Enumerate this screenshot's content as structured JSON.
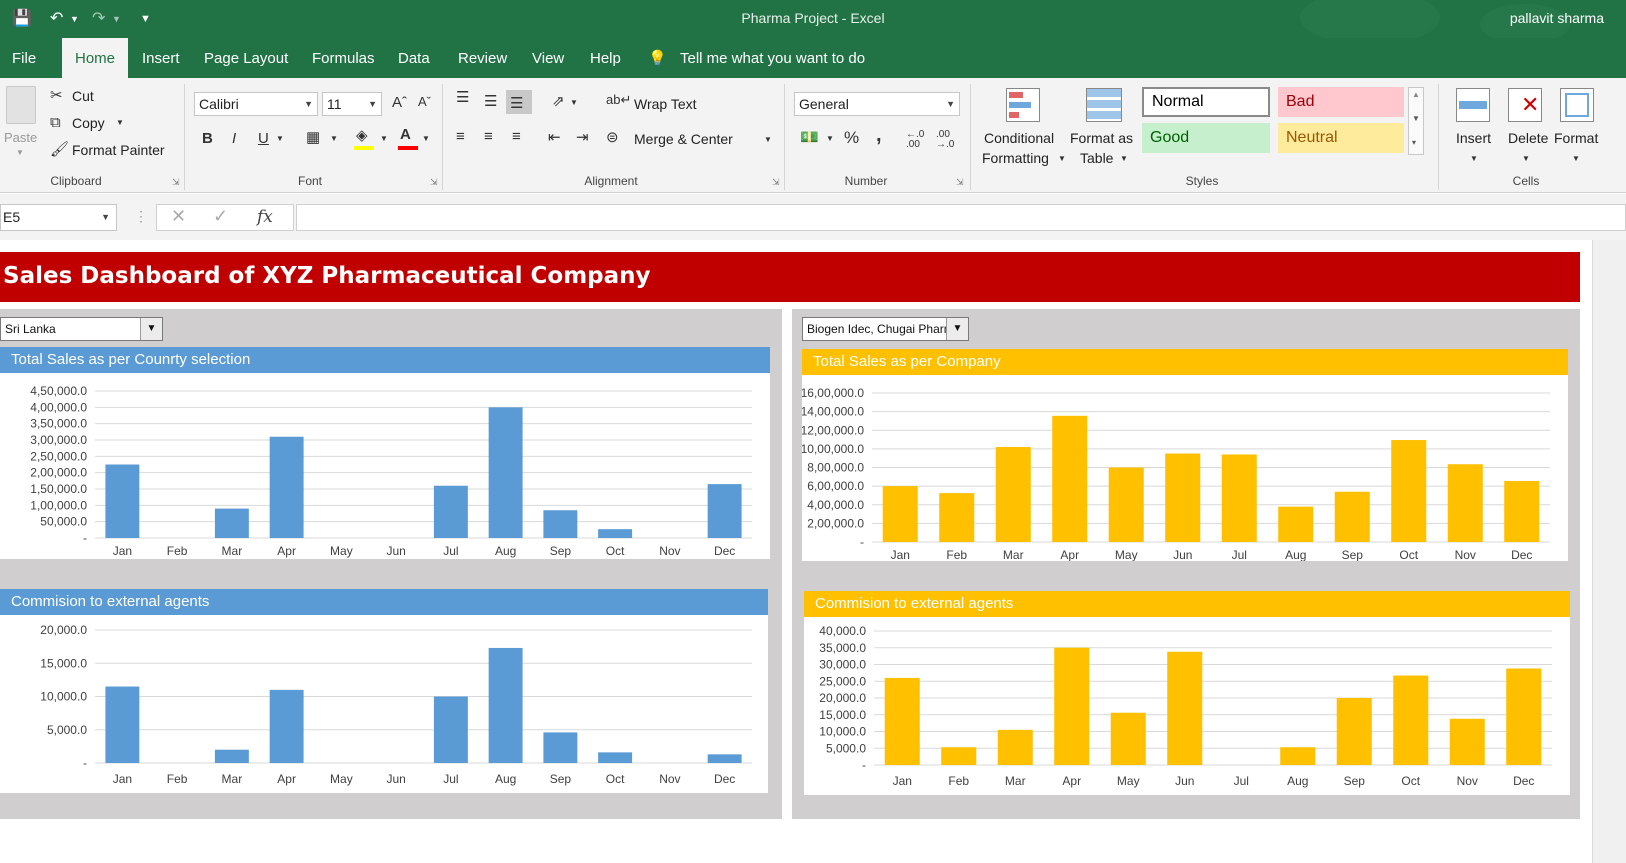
{
  "app": {
    "title": "Pharma Project  -  Excel",
    "user": "pallavit sharma"
  },
  "menu": {
    "tabs": [
      "File",
      "Home",
      "Insert",
      "Page Layout",
      "Formulas",
      "Data",
      "Review",
      "View",
      "Help"
    ],
    "active_tab": "Home",
    "tell_me": "Tell me what you want to do"
  },
  "ribbon": {
    "clipboard": {
      "paste": "Paste",
      "cut": "Cut",
      "copy": "Copy",
      "format_painter": "Format Painter",
      "label": "Clipboard"
    },
    "font": {
      "family": "Calibri",
      "size": "11",
      "label": "Font",
      "bold": "B",
      "italic": "I",
      "underline": "U"
    },
    "alignment": {
      "wrap_text": "Wrap Text",
      "merge_center": "Merge & Center",
      "label": "Alignment"
    },
    "number": {
      "format": "General",
      "percent": "%",
      "comma": ",",
      "label": "Number",
      "inc_decimal": "←.0\n.00",
      "dec_decimal": ".00\n→.0"
    },
    "styles": {
      "conditional_formatting": [
        "Conditional",
        "Formatting"
      ],
      "format_as_table": [
        "Format as",
        "Table"
      ],
      "normal": "Normal",
      "bad": "Bad",
      "good": "Good",
      "neutral": "Neutral",
      "label": "Styles"
    },
    "cells": {
      "insert": "Insert",
      "delete": "Delete",
      "format": "Format",
      "label": "Cells"
    }
  },
  "formula_bar": {
    "name_box": "E5",
    "formula": ""
  },
  "sheet": {
    "banner_title": "Sales Dashboard of XYZ Pharmaceutical Company",
    "country_select": "Sri Lanka",
    "company_select": "Biogen Idec, Chugai Pharm"
  },
  "colors": {
    "excel_green": "#217346",
    "banner_red": "#c00000",
    "blue": "#5b9bd5",
    "gold": "#ffc000",
    "panel_grey": "#d0cece"
  },
  "chart_data": [
    {
      "type": "bar",
      "title": "Total Sales as per Counrty selection",
      "categories": [
        "Jan",
        "Feb",
        "Mar",
        "Apr",
        "May",
        "Jun",
        "Jul",
        "Aug",
        "Sep",
        "Oct",
        "Nov",
        "Dec"
      ],
      "values": [
        225000,
        0,
        90000,
        310000,
        0,
        0,
        160000,
        400000,
        85000,
        27000,
        0,
        165000
      ],
      "ylim": [
        0,
        450000
      ],
      "yticks": [
        "-",
        "50,000.0",
        "1,00,000.0",
        "1,50,000.0",
        "2,00,000.0",
        "2,50,000.0",
        "3,00,000.0",
        "3,50,000.0",
        "4,00,000.0",
        "4,50,000.0"
      ],
      "color": "#5b9bd5",
      "grid": true
    },
    {
      "type": "bar",
      "title": "Commision to external agents",
      "categories": [
        "Jan",
        "Feb",
        "Mar",
        "Apr",
        "May",
        "Jun",
        "Jul",
        "Aug",
        "Sep",
        "Oct",
        "Nov",
        "Dec"
      ],
      "values": [
        11500,
        0,
        2000,
        11000,
        0,
        0,
        10000,
        17300,
        4600,
        1600,
        0,
        1300
      ],
      "ylim": [
        0,
        20000
      ],
      "yticks": [
        "-",
        "5,000.0",
        "10,000.0",
        "15,000.0",
        "20,000.0"
      ],
      "color": "#5b9bd5",
      "grid": true
    },
    {
      "type": "bar",
      "title": "Total Sales as per Company",
      "categories": [
        "Jan",
        "Feb",
        "Mar",
        "Apr",
        "May",
        "Jun",
        "Jul",
        "Aug",
        "Sep",
        "Oct",
        "Nov",
        "Dec"
      ],
      "values": [
        600000,
        525000,
        1020000,
        1355000,
        800000,
        950000,
        940000,
        380000,
        540000,
        1095000,
        835000,
        655000
      ],
      "ylim": [
        0,
        1600000
      ],
      "yticks": [
        "-",
        "2,00,000.0",
        "4,00,000.0",
        "6,00,000.0",
        "8,00,000.0",
        "10,00,000.0",
        "12,00,000.0",
        "14,00,000.0",
        "16,00,000.0"
      ],
      "color": "#ffc000",
      "grid": true
    },
    {
      "type": "bar",
      "title": "Commision to external agents",
      "categories": [
        "Jan",
        "Feb",
        "Mar",
        "Apr",
        "May",
        "Jun",
        "Jul",
        "Aug",
        "Sep",
        "Oct",
        "Nov",
        "Dec"
      ],
      "values": [
        26000,
        5300,
        10500,
        35000,
        15600,
        33800,
        0,
        5300,
        20000,
        26700,
        13800,
        28800
      ],
      "ylim": [
        0,
        40000
      ],
      "yticks": [
        "-",
        "5,000.0",
        "10,000.0",
        "15,000.0",
        "20,000.0",
        "25,000.0",
        "30,000.0",
        "35,000.0",
        "40,000.0"
      ],
      "color": "#ffc000",
      "grid": true
    }
  ]
}
